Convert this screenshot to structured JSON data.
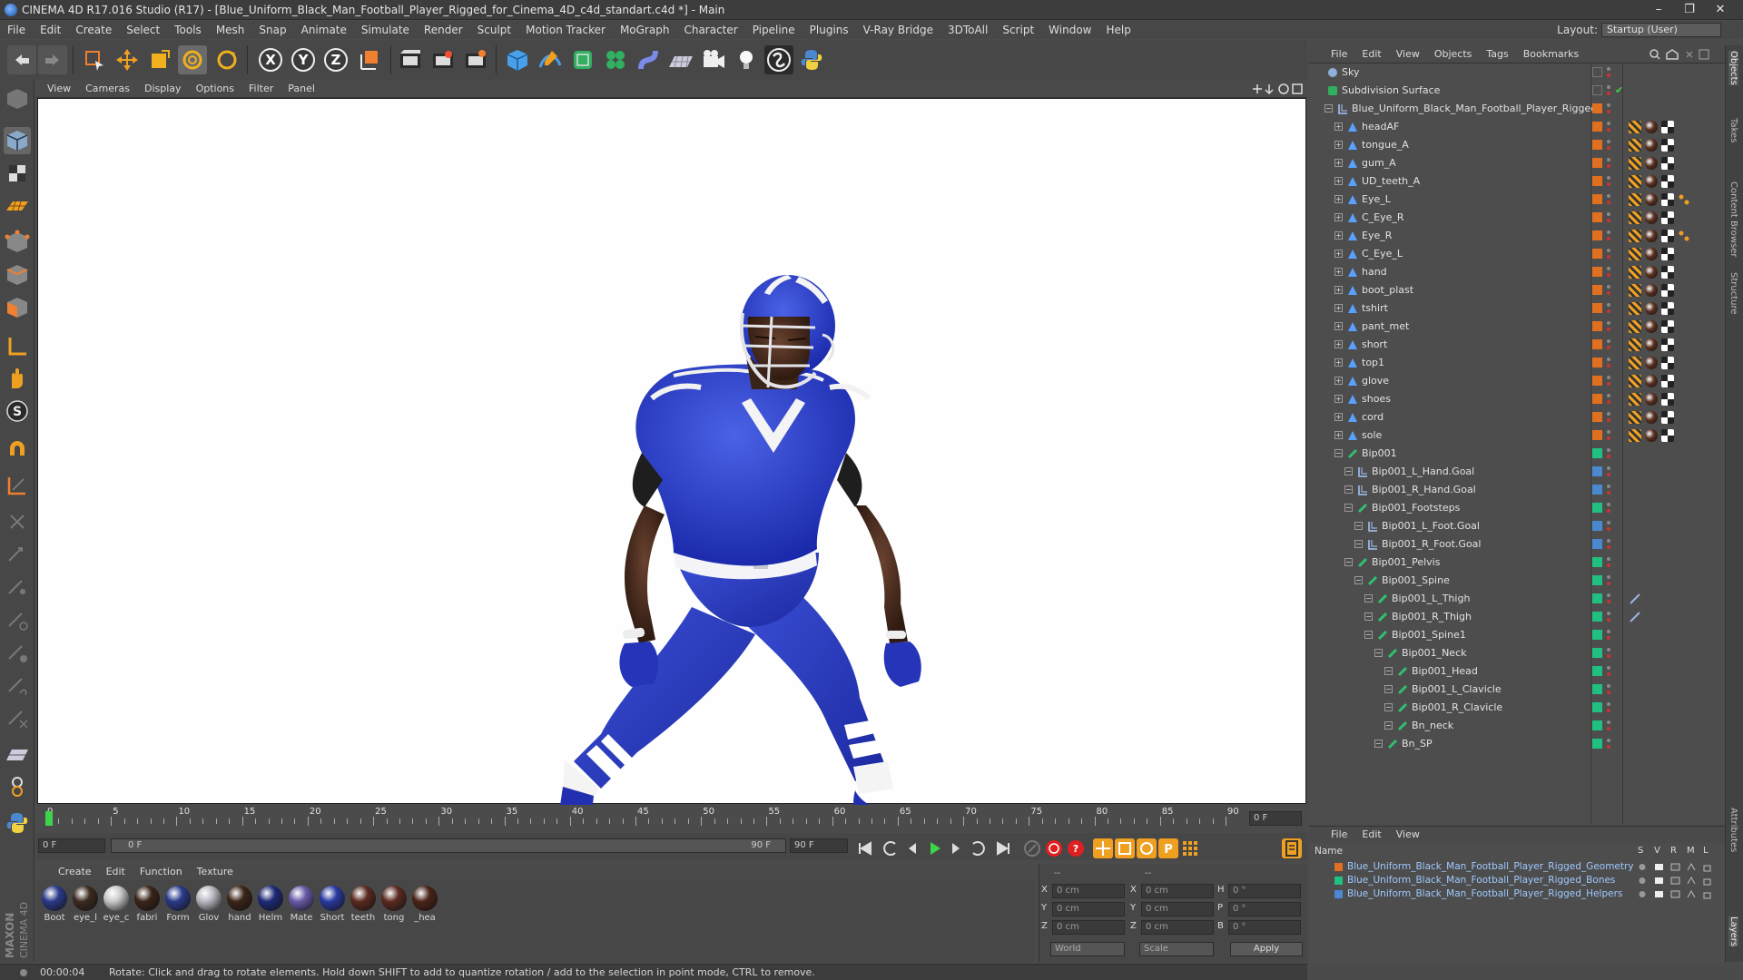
{
  "titlebar": {
    "title": "CINEMA 4D R17.016 Studio (R17) - [Blue_Uniform_Black_Man_Football_Player_Rigged_for_Cinema_4D_c4d_standart.c4d *] - Main",
    "minimize": "–",
    "restore": "❐",
    "close": "✕"
  },
  "menubar": {
    "items": [
      "File",
      "Edit",
      "Create",
      "Select",
      "Tools",
      "Mesh",
      "Snap",
      "Animate",
      "Simulate",
      "Render",
      "Sculpt",
      "Motion Tracker",
      "MoGraph",
      "Character",
      "Pipeline",
      "Plugins",
      "V-Ray Bridge",
      "3DToAll",
      "Script",
      "Window",
      "Help"
    ],
    "layout_label": "Layout:",
    "layout_value": "Startup (User)"
  },
  "toolbar": {
    "axis_x": "X",
    "axis_y": "Y",
    "axis_z": "Z"
  },
  "viewport": {
    "menu": [
      "View",
      "Cameras",
      "Display",
      "Options",
      "Filter",
      "Panel"
    ]
  },
  "timeline": {
    "labels": [
      "0",
      "5",
      "10",
      "15",
      "20",
      "25",
      "30",
      "35",
      "40",
      "45",
      "50",
      "55",
      "60",
      "65",
      "70",
      "75",
      "80",
      "85",
      "90"
    ],
    "current_frame": "0 F"
  },
  "playbar": {
    "start_field": "0 F",
    "range_start": "0 F",
    "range_end": "90 F",
    "end_field": "90 F"
  },
  "materials": {
    "menu": [
      "Create",
      "Edit",
      "Function",
      "Texture"
    ],
    "items": [
      {
        "label": "Boot",
        "color": "#2a3a8a"
      },
      {
        "label": "eye_l",
        "color": "#3c2a20"
      },
      {
        "label": "eye_c",
        "color": "#c8c8c8"
      },
      {
        "label": "fabri",
        "color": "#3a2418"
      },
      {
        "label": "Form",
        "color": "#2a3a8a"
      },
      {
        "label": "Glov",
        "color": "#b8b8c0"
      },
      {
        "label": "hand",
        "color": "#3a2418"
      },
      {
        "label": "Helm",
        "color": "#1e2a78"
      },
      {
        "label": "Mate",
        "color": "#6a5aa8"
      },
      {
        "label": "Short",
        "color": "#2a3aa0"
      },
      {
        "label": "teeth",
        "color": "#5a2a20"
      },
      {
        "label": "tong",
        "color": "#5a2a20"
      },
      {
        "label": "_hea",
        "color": "#4a2418"
      }
    ]
  },
  "coords": {
    "rows": [
      {
        "a": "X",
        "av": "0 cm",
        "b": "X",
        "bv": "0 cm",
        "c": "H",
        "cv": "0 °"
      },
      {
        "a": "Y",
        "av": "0 cm",
        "b": "Y",
        "bv": "0 cm",
        "c": "P",
        "cv": "0 °"
      },
      {
        "a": "Z",
        "av": "0 cm",
        "b": "Z",
        "bv": "0 cm",
        "c": "B",
        "cv": "0 °"
      }
    ],
    "dash1": "--",
    "dash2": "--",
    "world": "World",
    "scale": "Scale",
    "apply": "Apply"
  },
  "statusbar": {
    "time": "00:00:04",
    "message": "Rotate: Click and drag to rotate elements. Hold down SHIFT to add to quantize rotation / add to the selection in point mode, CTRL to remove."
  },
  "objects": {
    "menu": [
      "File",
      "Edit",
      "View",
      "Objects",
      "Tags",
      "Bookmarks"
    ],
    "rows": [
      {
        "name": "Sky",
        "indent": 0,
        "type": "sky",
        "layer": "",
        "tags": 0
      },
      {
        "name": "Subdivision Surface",
        "indent": 0,
        "type": "subd",
        "layer": "",
        "tags": 0,
        "check": true
      },
      {
        "name": "Blue_Uniform_Black_Man_Football_Player_Rigged",
        "indent": 1,
        "type": "null",
        "layer": "#e07020",
        "tags": 0
      },
      {
        "name": "headAF",
        "indent": 2,
        "type": "mesh",
        "layer": "#e07020",
        "tags": 3
      },
      {
        "name": "tongue_A",
        "indent": 2,
        "type": "mesh",
        "layer": "#e07020",
        "tags": 3
      },
      {
        "name": "gum_A",
        "indent": 2,
        "type": "mesh",
        "layer": "#e07020",
        "tags": 3
      },
      {
        "name": "UD_teeth_A",
        "indent": 2,
        "type": "mesh",
        "layer": "#e07020",
        "tags": 3
      },
      {
        "name": "Eye_L",
        "indent": 2,
        "type": "mesh",
        "layer": "#e07020",
        "tags": 4
      },
      {
        "name": "C_Eye_R",
        "indent": 2,
        "type": "mesh",
        "layer": "#e07020",
        "tags": 3
      },
      {
        "name": "Eye_R",
        "indent": 2,
        "type": "mesh",
        "layer": "#e07020",
        "tags": 4
      },
      {
        "name": "C_Eye_L",
        "indent": 2,
        "type": "mesh",
        "layer": "#e07020",
        "tags": 3
      },
      {
        "name": "hand",
        "indent": 2,
        "type": "mesh",
        "layer": "#e07020",
        "tags": 3
      },
      {
        "name": "boot_plast",
        "indent": 2,
        "type": "mesh",
        "layer": "#e07020",
        "tags": 3
      },
      {
        "name": "tshirt",
        "indent": 2,
        "type": "mesh",
        "layer": "#e07020",
        "tags": 3
      },
      {
        "name": "pant_met",
        "indent": 2,
        "type": "mesh",
        "layer": "#e07020",
        "tags": 3
      },
      {
        "name": "short",
        "indent": 2,
        "type": "mesh",
        "layer": "#e07020",
        "tags": 3
      },
      {
        "name": "top1",
        "indent": 2,
        "type": "mesh",
        "layer": "#e07020",
        "tags": 3
      },
      {
        "name": "glove",
        "indent": 2,
        "type": "mesh",
        "layer": "#e07020",
        "tags": 3
      },
      {
        "name": "shoes",
        "indent": 2,
        "type": "mesh",
        "layer": "#e07020",
        "tags": 3
      },
      {
        "name": "cord",
        "indent": 2,
        "type": "mesh",
        "layer": "#e07020",
        "tags": 3
      },
      {
        "name": "sole",
        "indent": 2,
        "type": "mesh",
        "layer": "#e07020",
        "tags": 3
      },
      {
        "name": "Bip001",
        "indent": 2,
        "type": "bone",
        "layer": "#20c080",
        "tags": 0
      },
      {
        "name": "Bip001_L_Hand.Goal",
        "indent": 3,
        "type": "null",
        "layer": "#4a88d0",
        "tags": 0
      },
      {
        "name": "Bip001_R_Hand.Goal",
        "indent": 3,
        "type": "null",
        "layer": "#4a88d0",
        "tags": 0
      },
      {
        "name": "Bip001_Footsteps",
        "indent": 3,
        "type": "bone",
        "layer": "#20c080",
        "tags": 0
      },
      {
        "name": "Bip001_L_Foot.Goal",
        "indent": 4,
        "type": "null",
        "layer": "#4a88d0",
        "tags": 0
      },
      {
        "name": "Bip001_R_Foot.Goal",
        "indent": 4,
        "type": "null",
        "layer": "#4a88d0",
        "tags": 0
      },
      {
        "name": "Bip001_Pelvis",
        "indent": 3,
        "type": "bone",
        "layer": "#20c080",
        "tags": 0
      },
      {
        "name": "Bip001_Spine",
        "indent": 4,
        "type": "bone",
        "layer": "#20c080",
        "tags": 0
      },
      {
        "name": "Bip001_L_Thigh",
        "indent": 5,
        "type": "bone",
        "layer": "#20c080",
        "tags": 1
      },
      {
        "name": "Bip001_R_Thigh",
        "indent": 5,
        "type": "bone",
        "layer": "#20c080",
        "tags": 1
      },
      {
        "name": "Bip001_Spine1",
        "indent": 5,
        "type": "bone",
        "layer": "#20c080",
        "tags": 0
      },
      {
        "name": "Bip001_Neck",
        "indent": 6,
        "type": "bone",
        "layer": "#20c080",
        "tags": 0
      },
      {
        "name": "Bip001_Head",
        "indent": 7,
        "type": "bone",
        "layer": "#20c080",
        "tags": 0
      },
      {
        "name": "Bip001_L_Clavicle",
        "indent": 7,
        "type": "bone",
        "layer": "#20c080",
        "tags": 0
      },
      {
        "name": "Bip001_R_Clavicle",
        "indent": 7,
        "type": "bone",
        "layer": "#20c080",
        "tags": 0
      },
      {
        "name": "Bn_neck",
        "indent": 7,
        "type": "bone",
        "layer": "#20c080",
        "tags": 0
      },
      {
        "name": "Bn_SP",
        "indent": 6,
        "type": "bone",
        "layer": "#20c080",
        "tags": 0
      }
    ]
  },
  "layers": {
    "menu": [
      "File",
      "Edit",
      "View"
    ],
    "col_name": "Name",
    "cols": [
      "S",
      "V",
      "R",
      "M",
      "L"
    ],
    "rows": [
      {
        "name": "Blue_Uniform_Black_Man_Football_Player_Rigged_Geometry",
        "color": "#e07020"
      },
      {
        "name": "Blue_Uniform_Black_Man_Football_Player_Rigged_Bones",
        "color": "#20c080"
      },
      {
        "name": "Blue_Uniform_Black_Man_Football_Player_Rigged_Helpers",
        "color": "#4a88d0"
      }
    ]
  },
  "righttabs": [
    "Objects",
    "Takes",
    "Content Browser",
    "Structure",
    "Attributes",
    "Layers"
  ],
  "brand": {
    "maxon": "MAXON",
    "c4d": "CINEMA 4D"
  }
}
